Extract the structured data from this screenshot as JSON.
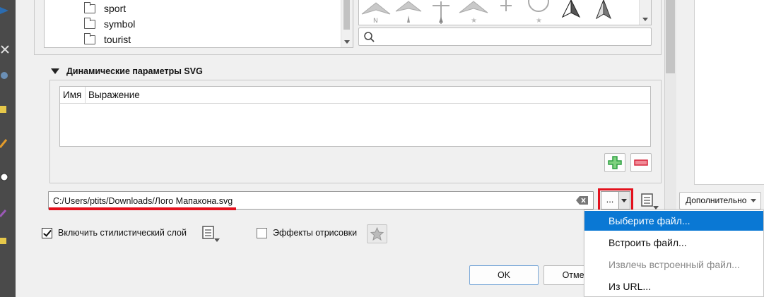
{
  "folder_tree": {
    "items": [
      "sport",
      "symbol",
      "tourist"
    ]
  },
  "svg_search": {
    "placeholder": ""
  },
  "dynamic_params": {
    "title": "Динамические параметры SVG",
    "columns": [
      "Имя",
      "Выражение"
    ]
  },
  "path_field": {
    "value": "C:/Users/ptits/Downloads/Лого Мапакона.svg"
  },
  "browse_button": {
    "label": "..."
  },
  "style_layer": {
    "label": "Включить стилистический слой",
    "checked": true
  },
  "effects": {
    "label": "Эффекты отрисовки",
    "checked": false
  },
  "dialog_buttons": {
    "ok": "OK",
    "cancel": "Отмена"
  },
  "advanced_button": {
    "label": "Дополнительно"
  },
  "file_menu": {
    "items": [
      {
        "label": "Выберите файл...",
        "state": "selected"
      },
      {
        "label": "Встроить файл...",
        "state": "normal"
      },
      {
        "label": "Извлечь встроенный файл...",
        "state": "disabled"
      },
      {
        "label": "Из URL...",
        "state": "normal"
      }
    ]
  },
  "colors": {
    "highlight_red": "#e3111d",
    "menu_selection": "#0a78d4",
    "add_green": "#2ea043",
    "remove_red": "#d7263d"
  }
}
